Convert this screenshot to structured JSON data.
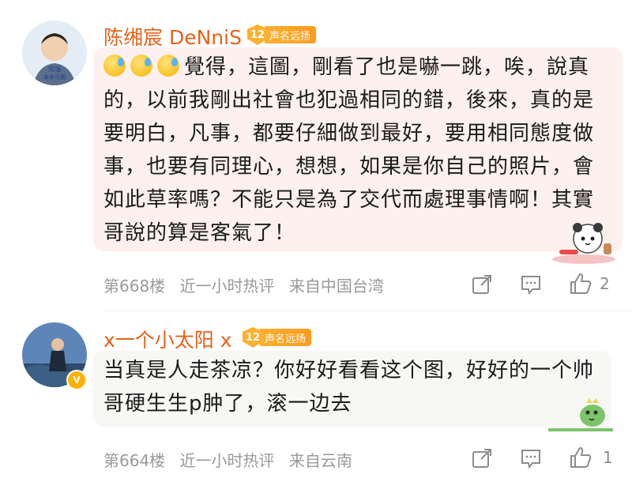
{
  "comments": [
    {
      "username": "陈缃宸 DeNniS",
      "badge_level": "12",
      "badge_text": "声名远扬",
      "avatar_caption_1": "加油",
      "avatar_caption_2": "未来可期",
      "text": "覺得，這圖，剛看了也是嚇一跳，唉，說真的，以前我剛出社會也犯過相同的錯，後來，真的是要明白，凡事，都要仔細做到最好，要用相同態度做事，也要有同理心，想想，如果是你自己的照片，會如此草率嗎？不能只是為了交代而處理事情啊！其實哥說的算是客氣了！",
      "floor": "第668楼",
      "time": "近一小时热评",
      "source": "来自中国台湾",
      "like_count": "2",
      "icons": [
        "share-icon",
        "comment-icon",
        "like-icon"
      ]
    },
    {
      "username": "x一个小太阳 x",
      "badge_level": "12",
      "badge_text": "声名远扬",
      "text": "当真是人走茶凉？你好好看看这个图，好好的一个帅哥硬生生p肿了，滚一边去",
      "floor": "第664楼",
      "time": "近一小时热评",
      "source": "来自云南",
      "like_count": "1",
      "icons": [
        "share-icon",
        "comment-icon",
        "like-icon"
      ]
    }
  ],
  "colors": {
    "username": "#e8621a",
    "bubble": "#fdf0ef",
    "bubble2": "#f7f7f4",
    "meta": "#9a9a9a"
  }
}
